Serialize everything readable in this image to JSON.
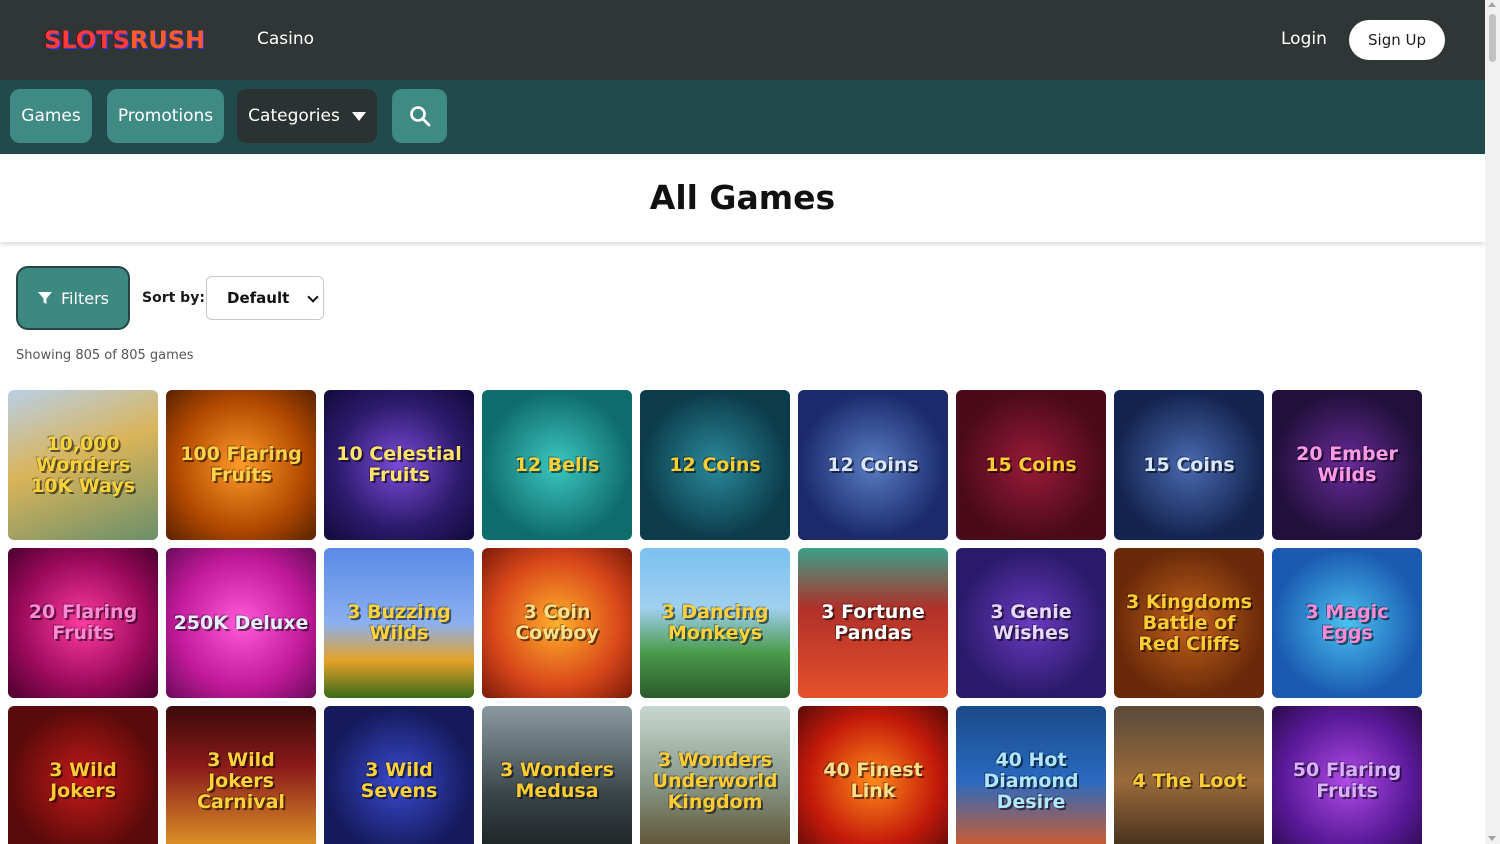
{
  "header": {
    "logo_part1": "SLOTS",
    "logo_part2": "RUSH",
    "casino_link": "Casino",
    "login": "Login",
    "signup": "Sign Up"
  },
  "nav": {
    "games": "Games",
    "promotions": "Promotions",
    "categories": "Categories",
    "search_icon": "search-icon"
  },
  "main": {
    "title": "All Games",
    "filters_label": "Filters",
    "sort_label": "Sort by:",
    "sort_value": "Default",
    "showing": "Showing 805 of 805 games"
  },
  "games": [
    {
      "name": "10,000 Wonders 10K Ways",
      "bg": "linear-gradient(160deg,#b9cfe6,#d9b45a 45%,#6a8f6a)",
      "color": "#f7d23a"
    },
    {
      "name": "100 Flaring Fruits",
      "bg": "radial-gradient(circle,#ff9a2a,#b34a00 60%,#5a2200)",
      "color": "#ffd24a"
    },
    {
      "name": "10 Celestial Fruits",
      "bg": "radial-gradient(circle,#7a4bd8,#2b1a6a 60%,#120a3a)",
      "color": "#ffe36a"
    },
    {
      "name": "12 Bells",
      "bg": "radial-gradient(circle,#3cc7c0,#0f6c6c 70%)",
      "color": "#ffd23a"
    },
    {
      "name": "12 Coins",
      "bg": "radial-gradient(circle,#2a8a9a,#0c3b4a 70%)",
      "color": "#ffcc33"
    },
    {
      "name": "12 Coins",
      "bg": "radial-gradient(circle,#5a7cc4,#1a2a6a 70%)",
      "color": "#d8e6ff"
    },
    {
      "name": "15 Coins",
      "bg": "radial-gradient(circle,#9a1a3a,#4a0a1a 70%)",
      "color": "#ffcc33"
    },
    {
      "name": "15 Coins",
      "bg": "radial-gradient(circle,#4a6ab0,#142450 70%)",
      "color": "#d8e6ff"
    },
    {
      "name": "20 Ember Wilds",
      "bg": "radial-gradient(circle,#6a2a9a,#20103a 70%)",
      "color": "#ff9ae6"
    },
    {
      "name": "20 Flaring Fruits",
      "bg": "radial-gradient(circle,#ff3aa0,#9a0a5a 60%,#4a0030)",
      "color": "#ff8ad8"
    },
    {
      "name": "250K Deluxe",
      "bg": "radial-gradient(circle,#ff5ad8,#c21a9a 60%,#6a0a5a)",
      "color": "#e8ecff"
    },
    {
      "name": "3 Buzzing Wilds",
      "bg": "linear-gradient(180deg,#5a8ae6,#8ab0f0 50%,#e6a22a 75%,#3a6a1a)",
      "color": "#ffd23a"
    },
    {
      "name": "3 Coin Cowboy",
      "bg": "radial-gradient(circle,#ffb02a,#d9471a 60%,#7a1a0a)",
      "color": "#ffe08a"
    },
    {
      "name": "3 Dancing Monkeys",
      "bg": "linear-gradient(180deg,#7ac0f0,#a0d0f0 40%,#4a9a4a 70%,#2a5a2a)",
      "color": "#ffd23a"
    },
    {
      "name": "3 Fortune Pandas",
      "bg": "linear-gradient(180deg,#3aa08a,#b0302a 40%,#e6512a)",
      "color": "#ffffff"
    },
    {
      "name": "3 Genie Wishes",
      "bg": "radial-gradient(circle,#6a3ac0,#2a1a6a 70%)",
      "color": "#e6d8ff"
    },
    {
      "name": "3 Kingdoms Battle of Red Cliffs",
      "bg": "radial-gradient(circle,#c4621a,#6a2a0a 70%)",
      "color": "#ffcc33"
    },
    {
      "name": "3 Magic Eggs",
      "bg": "radial-gradient(circle,#4ac0f0,#1a5ab0 70%)",
      "color": "#ff8ad8"
    },
    {
      "name": "3 Wild Jokers",
      "bg": "radial-gradient(circle,#c41a1a,#5a0a0a 70%)",
      "color": "#ffcc33"
    },
    {
      "name": "3 Wild Jokers Carnival",
      "bg": "linear-gradient(180deg,#3a0a0a,#8a1a1a 40%,#e6a02a)",
      "color": "#ffd23a"
    },
    {
      "name": "3 Wild Sevens",
      "bg": "radial-gradient(circle,#3a4ad0,#141a5a 70%)",
      "color": "#ffd23a"
    },
    {
      "name": "3 Wonders Medusa",
      "bg": "linear-gradient(180deg,#8a9aa0,#3a4448 60%,#1a2022)",
      "color": "#ffcc33"
    },
    {
      "name": "3 Wonders Underworld Kingdom",
      "bg": "linear-gradient(180deg,#c8d8d0,#8a9a8a 50%,#5a4a2a)",
      "color": "#ffcc33"
    },
    {
      "name": "40 Finest Link",
      "bg": "radial-gradient(circle,#ff8a1a,#c41a0a 60%,#5a0a0a)",
      "color": "#ffe08a"
    },
    {
      "name": "40 Hot Diamond Desire",
      "bg": "linear-gradient(180deg,#1a4a8a,#2a6ac0 50%,#e65a1a)",
      "color": "#aee6ff"
    },
    {
      "name": "4 The Loot",
      "bg": "linear-gradient(180deg,#5a4a3a,#9a6a3a 50%,#3a2a1a)",
      "color": "#ffcc33"
    },
    {
      "name": "50 Flaring Fruits",
      "bg": "radial-gradient(circle,#b04ae6,#5a1a9a 60%,#2a0a4a)",
      "color": "#d8b0ff"
    }
  ]
}
